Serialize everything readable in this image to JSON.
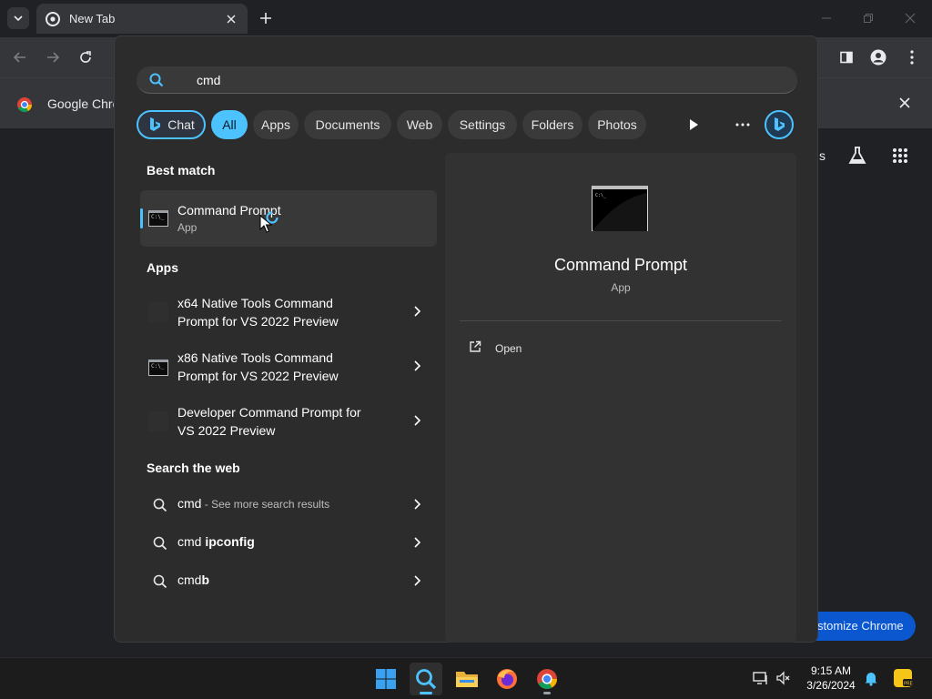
{
  "chrome": {
    "tab_title": "New Tab",
    "infobar_text": "Google Chro",
    "customize_label": "stomize Chrome",
    "partial_label": "s"
  },
  "search": {
    "query": "cmd",
    "filters": [
      "Chat",
      "All",
      "Apps",
      "Documents",
      "Web",
      "Settings",
      "Folders",
      "Photos"
    ],
    "active_filter": "All"
  },
  "best_match": {
    "heading": "Best match",
    "title": "Command Prompt",
    "subtitle": "App"
  },
  "apps": {
    "heading": "Apps",
    "items": [
      {
        "line1": "x64 Native Tools Command",
        "line2": "Prompt for VS 2022 Preview"
      },
      {
        "line1": "x86 Native Tools Command",
        "line2": "Prompt for VS 2022 Preview"
      },
      {
        "line1": "Developer Command Prompt for",
        "line2": "VS 2022 Preview"
      }
    ]
  },
  "web": {
    "heading": "Search the web",
    "items": [
      {
        "prefix": "cmd",
        "suffix": " - See more search results"
      },
      {
        "prefix": "cmd ",
        "bold": "ipconfig"
      },
      {
        "prefix": "cmd",
        "bold": "b"
      }
    ]
  },
  "preview": {
    "title": "Command Prompt",
    "subtitle": "App",
    "actions": [
      "Open"
    ]
  },
  "taskbar": {
    "time": "9:15 AM",
    "date": "3/26/2024"
  },
  "colors": {
    "accent": "#4cc2ff",
    "panel": "#2c2c2c",
    "chrome_toolbar": "#35363a"
  }
}
